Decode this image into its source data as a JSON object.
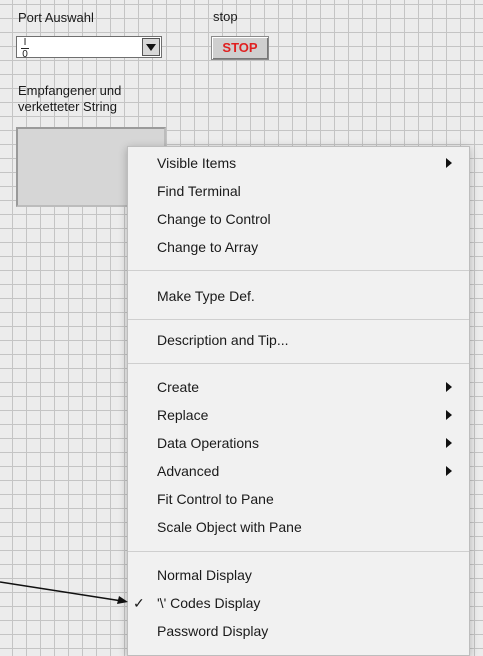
{
  "panel": {
    "port_label": "Port Auswahl",
    "stop_label": "stop",
    "stop_button": "STOP",
    "io_icon_top": "I",
    "io_icon_bottom": "0",
    "string_label": "Empfangener und verketteter String"
  },
  "menu": {
    "items": [
      {
        "label": "Visible Items",
        "submenu": true
      },
      {
        "label": "Find Terminal"
      },
      {
        "label": "Change to Control"
      },
      {
        "label": "Change to Array"
      },
      {
        "label": "Make Type Def."
      },
      {
        "label": "Description and Tip..."
      },
      {
        "label": "Create",
        "submenu": true
      },
      {
        "label": "Replace",
        "submenu": true
      },
      {
        "label": "Data Operations",
        "submenu": true
      },
      {
        "label": "Advanced",
        "submenu": true
      },
      {
        "label": "Fit Control to Pane"
      },
      {
        "label": "Scale Object with Pane"
      },
      {
        "label": "Normal Display"
      },
      {
        "label": "'\\' Codes Display",
        "checked": true
      },
      {
        "label": "Password Display"
      }
    ],
    "check_mark": "✓"
  },
  "colors": {
    "stop_text": "#e02020",
    "grid_line": "#c4c4c4",
    "menu_bg": "#f1f1f1"
  }
}
